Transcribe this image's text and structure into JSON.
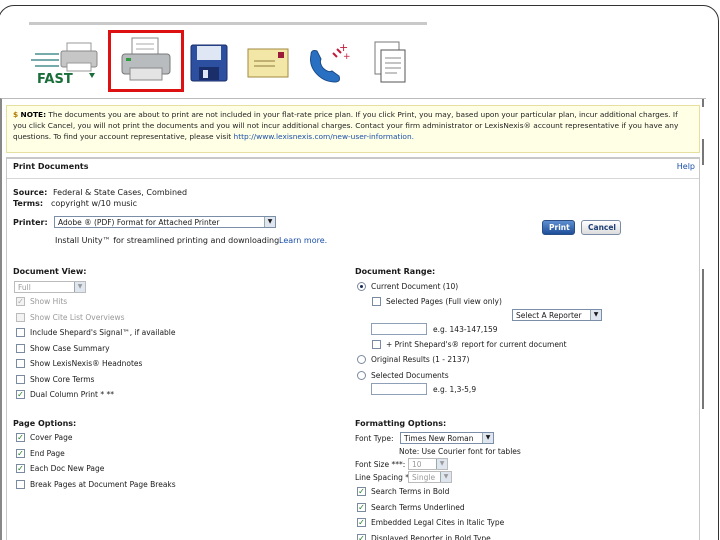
{
  "toolbar": {
    "items": [
      {
        "name": "fast-print",
        "label": "FAST"
      },
      {
        "name": "print"
      },
      {
        "name": "save"
      },
      {
        "name": "email"
      },
      {
        "name": "fax"
      },
      {
        "name": "document"
      }
    ],
    "active": "print"
  },
  "note": {
    "label": "NOTE:",
    "text": "The documents you are about to print are not included in your flat-rate price plan. If you click Print, you may, based upon your particular plan, incur additional charges. If you click Cancel, you will not print the documents and you will not incur additional charges. Contact your firm administrator or LexisNexis® account representative if you have any questions. To find your account representative, please visit",
    "link": "http://www.lexisnexis.com/new-user-information."
  },
  "panel": {
    "title": "Print Documents",
    "help": "Help",
    "source_label": "Source:",
    "source_value": "Federal & State Cases, Combined",
    "terms_label": "Terms:",
    "terms_value": "copyright w/10 music",
    "printer_label": "Printer:",
    "printer_value": "Adobe ® (PDF) Format for Attached Printer",
    "install_text": "Install Unity™ for streamlined printing and downloading.",
    "learn_more": "Learn more.",
    "print_button": "Print",
    "cancel_button": "Cancel"
  },
  "document_view": {
    "title": "Document View:",
    "select_value": "Full",
    "options": [
      {
        "label": "Show Hits",
        "checked": true,
        "disabled": true
      },
      {
        "label": "Show Cite List Overviews",
        "checked": false,
        "disabled": true
      },
      {
        "label": "Include Shepard's Signal™, if available",
        "checked": false,
        "disabled": false
      },
      {
        "label": "Show Case Summary",
        "checked": false,
        "disabled": false
      },
      {
        "label": "Show LexisNexis® Headnotes",
        "checked": false,
        "disabled": false
      },
      {
        "label": "Show Core Terms",
        "checked": false,
        "disabled": false
      },
      {
        "label": "Dual Column Print * **",
        "checked": true,
        "disabled": false
      }
    ]
  },
  "document_range": {
    "title": "Document Range:",
    "current": "Current Document (10)",
    "selected_pages": "Selected Pages (Full view only)",
    "reporter_select": "Select A Reporter",
    "pages_example": "e.g. 143-147,159",
    "shepards": "+ Print Shepard's® report for current document",
    "original_results": "Original Results (1 - 2137)",
    "selected_documents": "Selected Documents",
    "docs_example": "e.g. 1,3-5,9"
  },
  "page_options": {
    "title": "Page Options:",
    "options": [
      {
        "label": "Cover Page",
        "checked": true
      },
      {
        "label": "End Page",
        "checked": true
      },
      {
        "label": "Each Doc New Page",
        "checked": true
      },
      {
        "label": "Break Pages at Document Page Breaks",
        "checked": false
      }
    ]
  },
  "formatting": {
    "title": "Formatting Options:",
    "font_type_label": "Font Type:",
    "font_type_value": "Times New Roman",
    "font_note": "Note: Use Courier font for tables",
    "font_size_label": "Font Size ***:",
    "font_size_value": "10",
    "line_spacing_label": "Line Spacing ***:",
    "line_spacing_value": "Single",
    "options": [
      {
        "label": "Search Terms in Bold",
        "checked": true
      },
      {
        "label": "Search Terms Underlined",
        "checked": true
      },
      {
        "label": "Embedded Legal Cites in Italic Type",
        "checked": true
      },
      {
        "label": "Displayed Reporter in Bold Type",
        "checked": true
      }
    ]
  }
}
